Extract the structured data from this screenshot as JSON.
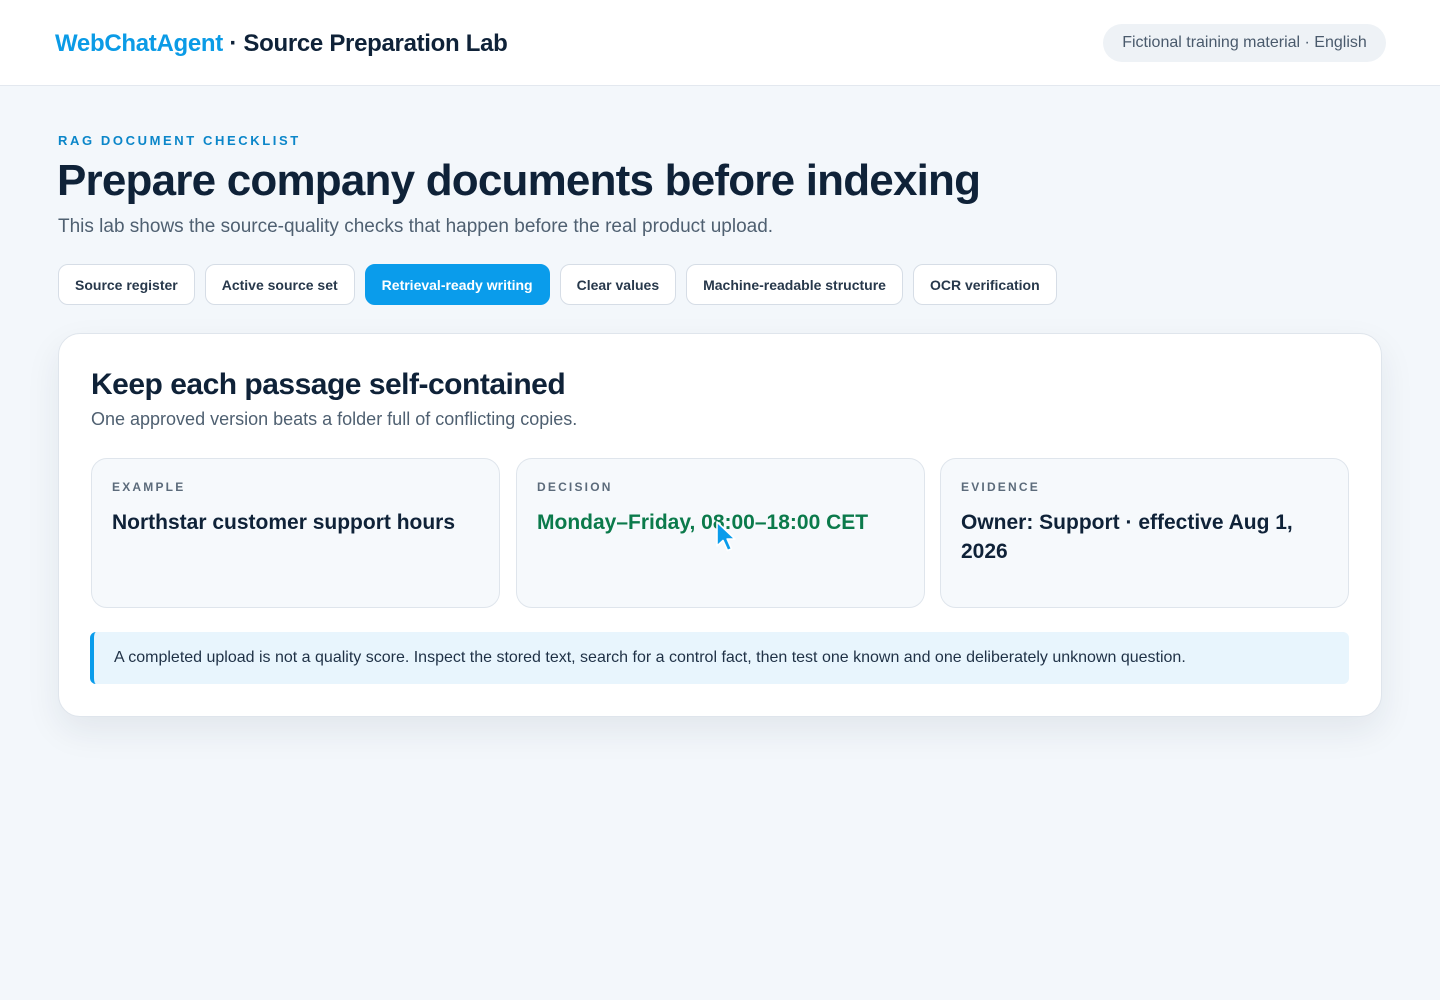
{
  "header": {
    "brand_name": "WebChatAgent",
    "brand_separator": " · ",
    "app_name": "Source Preparation Lab",
    "badge": "Fictional training material · English"
  },
  "hero": {
    "eyebrow": "RAG DOCUMENT CHECKLIST",
    "title": "Prepare company documents before indexing",
    "subtitle": "This lab shows the source-quality checks that happen before the real product upload."
  },
  "tabs": [
    {
      "label": "Source register",
      "active": false
    },
    {
      "label": "Active source set",
      "active": false
    },
    {
      "label": "Retrieval-ready writing",
      "active": true
    },
    {
      "label": "Clear values",
      "active": false
    },
    {
      "label": "Machine-readable structure",
      "active": false
    },
    {
      "label": "OCR verification",
      "active": false
    }
  ],
  "panel": {
    "title": "Keep each passage self-contained",
    "subtitle": "One approved version beats a folder full of conflicting copies.",
    "cards": [
      {
        "label": "EXAMPLE",
        "value": "Northstar customer support hours"
      },
      {
        "label": "DECISION",
        "value": "Monday–Friday, 08:00–18:00 CET"
      },
      {
        "label": "EVIDENCE",
        "value": "Owner: Support · effective Aug 1, 2026"
      }
    ],
    "note": "A completed upload is not a quality score. Inspect the stored text, search for a control fact, then test one known and one deliberately unknown question."
  },
  "colors": {
    "accent": "#0a9ceb",
    "brand": "#0b9be6",
    "decision": "#0b7a4b",
    "heading": "#0f2238"
  },
  "icons": {
    "cursor": "mouse-pointer-icon"
  }
}
